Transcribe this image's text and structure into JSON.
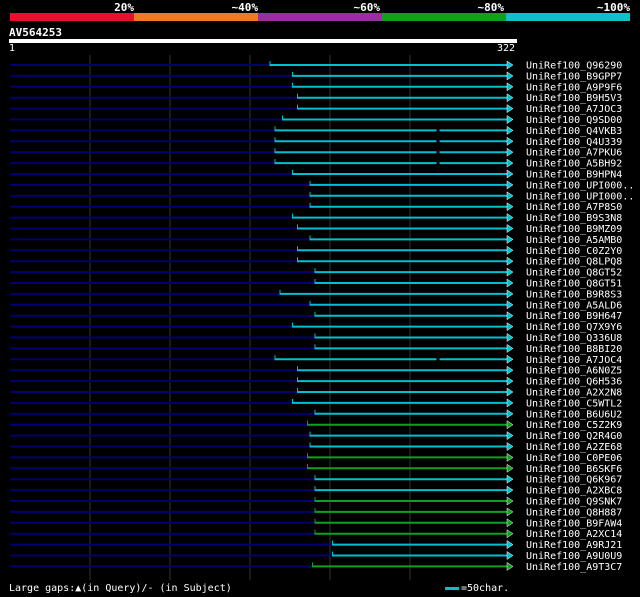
{
  "legend": {
    "labels": [
      "20%",
      "~40%",
      "~60%",
      "~80%",
      "~100%"
    ],
    "colors": [
      "#e8102c",
      "#f07a20",
      "#9a30a0",
      "#10a020",
      "#10c0c8"
    ]
  },
  "query": {
    "name": "AV564253",
    "start": "1",
    "end": "322"
  },
  "row_colors": {
    "cyan": "#00c0d0",
    "green": "#10a020",
    "dark": "#000070"
  },
  "hits": [
    {
      "label": "UniRef100_Q96290",
      "s": 0.52,
      "c": "cyan"
    },
    {
      "label": "UniRef100_B9GPP7",
      "s": 0.565,
      "c": "cyan"
    },
    {
      "label": "UniRef100_A9P9F6",
      "s": 0.565,
      "c": "cyan"
    },
    {
      "label": "UniRef100_B9H5V3",
      "s": 0.575,
      "c": "cyan"
    },
    {
      "label": "UniRef100_A7JOC3",
      "s": 0.575,
      "c": "cyan"
    },
    {
      "label": "UniRef100_Q9SD00",
      "s": 0.545,
      "c": "cyan"
    },
    {
      "label": "UniRef100_Q4VKB3",
      "s": 0.53,
      "c": "cyan",
      "gap": 0.855
    },
    {
      "label": "UniRef100_Q4U339",
      "s": 0.53,
      "c": "cyan",
      "gap": 0.855
    },
    {
      "label": "UniRef100_A7PKU6",
      "s": 0.53,
      "c": "cyan",
      "gap": 0.855
    },
    {
      "label": "UniRef100_A5BH92",
      "s": 0.53,
      "c": "cyan",
      "gap": 0.855
    },
    {
      "label": "UniRef100_B9HPN4",
      "s": 0.565,
      "c": "cyan"
    },
    {
      "label": "UniRef100_UPI000..",
      "s": 0.6,
      "c": "cyan"
    },
    {
      "label": "UniRef100_UPI000..",
      "s": 0.6,
      "c": "cyan"
    },
    {
      "label": "UniRef100_A7P8S0",
      "s": 0.6,
      "c": "cyan"
    },
    {
      "label": "UniRef100_B9S3N8",
      "s": 0.565,
      "c": "cyan"
    },
    {
      "label": "UniRef100_B9MZ09",
      "s": 0.575,
      "c": "cyan"
    },
    {
      "label": "UniRef100_A5AMB0",
      "s": 0.6,
      "c": "cyan"
    },
    {
      "label": "UniRef100_C0Z2Y0",
      "s": 0.575,
      "c": "cyan"
    },
    {
      "label": "UniRef100_Q8LPQ8",
      "s": 0.575,
      "c": "cyan"
    },
    {
      "label": "UniRef100_Q8GT52",
      "s": 0.61,
      "c": "cyan"
    },
    {
      "label": "UniRef100_Q8GT51",
      "s": 0.61,
      "c": "cyan"
    },
    {
      "label": "UniRef100_B9R8S3",
      "s": 0.54,
      "c": "cyan"
    },
    {
      "label": "UniRef100_A5ALD6",
      "s": 0.6,
      "c": "cyan"
    },
    {
      "label": "UniRef100_B9H647",
      "s": 0.61,
      "c": "cyan"
    },
    {
      "label": "UniRef100_Q7X9Y6",
      "s": 0.565,
      "c": "cyan"
    },
    {
      "label": "UniRef100_Q336U8",
      "s": 0.61,
      "c": "cyan"
    },
    {
      "label": "UniRef100_B8BI20",
      "s": 0.61,
      "c": "cyan"
    },
    {
      "label": "UniRef100_A7JOC4",
      "s": 0.53,
      "c": "cyan",
      "gap": 0.855
    },
    {
      "label": "UniRef100_A6N0Z5",
      "s": 0.575,
      "c": "cyan"
    },
    {
      "label": "UniRef100_Q6H536",
      "s": 0.575,
      "c": "cyan"
    },
    {
      "label": "UniRef100_A2X2N8",
      "s": 0.575,
      "c": "cyan"
    },
    {
      "label": "UniRef100_C5WTL2",
      "s": 0.565,
      "c": "cyan"
    },
    {
      "label": "UniRef100_B6U6U2",
      "s": 0.61,
      "c": "cyan"
    },
    {
      "label": "UniRef100_C5Z2K9",
      "s": 0.595,
      "c": "green"
    },
    {
      "label": "UniRef100_Q2R4G0",
      "s": 0.6,
      "c": "cyan"
    },
    {
      "label": "UniRef100_A2ZE68",
      "s": 0.6,
      "c": "cyan"
    },
    {
      "label": "UniRef100_C0PE06",
      "s": 0.595,
      "c": "green"
    },
    {
      "label": "UniRef100_B6SKF6",
      "s": 0.595,
      "c": "green"
    },
    {
      "label": "UniRef100_Q6K967",
      "s": 0.61,
      "c": "cyan"
    },
    {
      "label": "UniRef100_A2XBC8",
      "s": 0.61,
      "c": "cyan"
    },
    {
      "label": "UniRef100_Q9SNK7",
      "s": 0.61,
      "c": "green"
    },
    {
      "label": "UniRef100_Q8H887",
      "s": 0.61,
      "c": "green"
    },
    {
      "label": "UniRef100_B9FAW4",
      "s": 0.61,
      "c": "green"
    },
    {
      "label": "UniRef100_A2XC14",
      "s": 0.61,
      "c": "green"
    },
    {
      "label": "UniRef100_A9RJ21",
      "s": 0.645,
      "c": "cyan"
    },
    {
      "label": "UniRef100_A9U0U9",
      "s": 0.645,
      "c": "cyan"
    },
    {
      "label": "UniRef100_A9T3C7",
      "s": 0.605,
      "c": "green"
    }
  ],
  "footer": {
    "gaps_text": "Large gaps:▲(in Query)/- (in Subject)",
    "scale_text": "=50char."
  }
}
